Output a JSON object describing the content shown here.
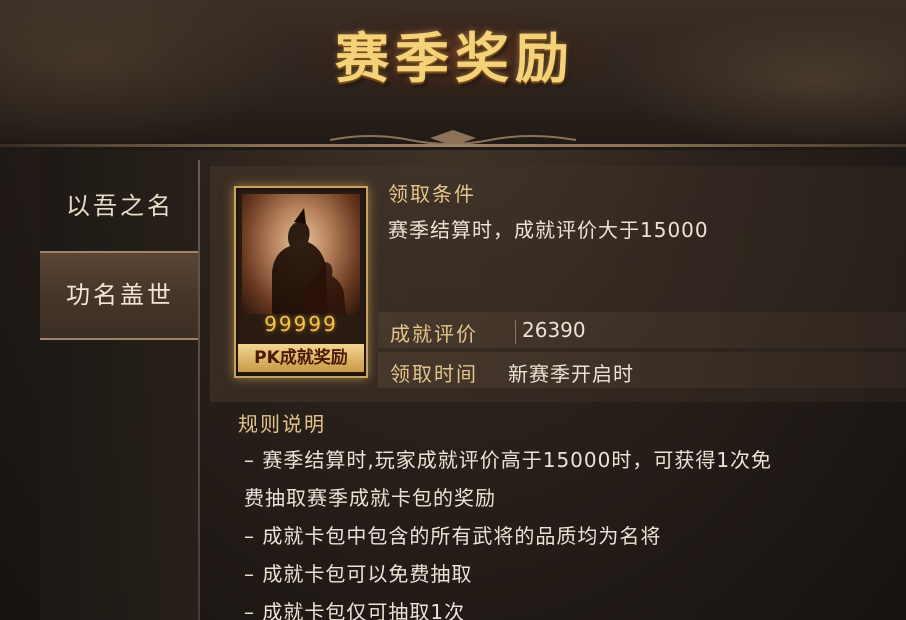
{
  "header": {
    "title": "赛季奖励"
  },
  "sidebar": {
    "tabs": [
      {
        "label": "以吾之名",
        "active": false
      },
      {
        "label": "功名盖世",
        "active": true
      }
    ]
  },
  "reward": {
    "card_label": "PK成就奖励",
    "card_gems": "99999",
    "condition_title": "领取条件",
    "condition_text": "赛季结算时，成就评价大于15000",
    "score_label": "成就评价",
    "score_value": "26390",
    "time_label": "领取时间",
    "time_value": "新赛季开启时"
  },
  "rules": {
    "title": "规则说明",
    "items": [
      "– 赛季结算时,玩家成就评价高于15000时，可获得1次免",
      "费抽取赛季成就卡包的奖励",
      "– 成就卡包中包含的所有武将的品质均为名将",
      "– 成就卡包可以免费抽取",
      "– 成就卡包仅可抽取1次"
    ]
  },
  "colors": {
    "accent_gold": "#e3c48a",
    "title_gold": "#f4d27a",
    "text": "#ece3d4"
  }
}
